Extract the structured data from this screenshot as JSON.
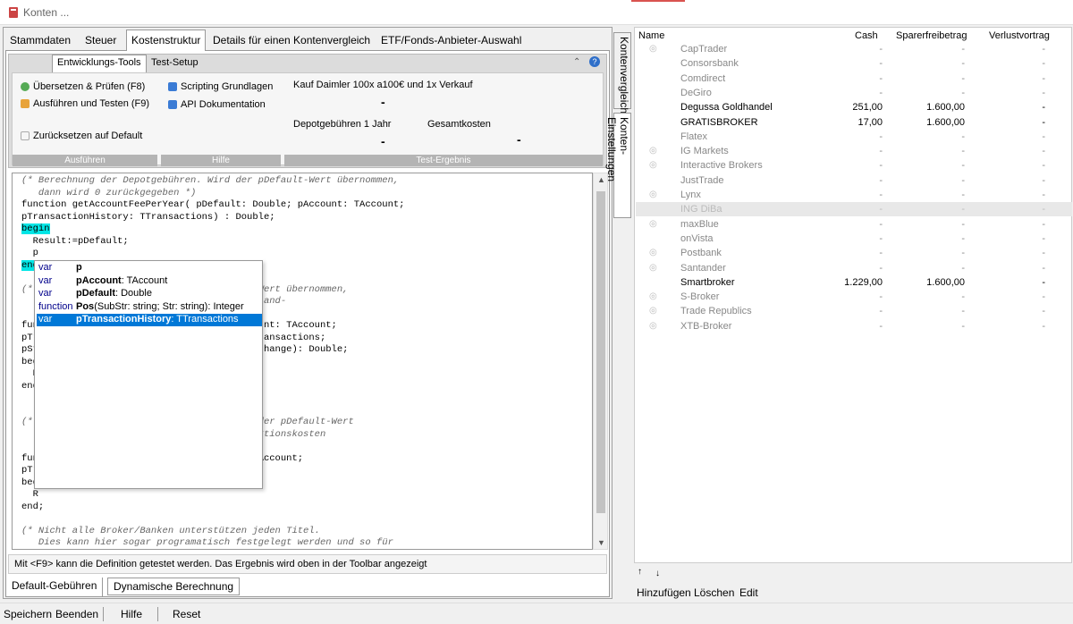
{
  "window": {
    "title": "Konten ..."
  },
  "main_tabs": [
    "Stammdaten",
    "Steuer",
    "Kostenstruktur",
    "Details für einen Kontenvergleich",
    "ETF/Fonds-Anbieter-Auswahl"
  ],
  "sub_tabs": [
    "Entwicklungs-Tools",
    "Test-Setup"
  ],
  "ribbon": {
    "ausfuehren": {
      "items": [
        "Übersetzen & Prüfen (F8)",
        "Ausführen und Testen (F9)",
        "Zurücksetzen auf Default"
      ],
      "footer": "Ausführen"
    },
    "hilfe": {
      "items": [
        "Scripting Grundlagen",
        "API Dokumentation"
      ],
      "footer": "Hilfe"
    },
    "test": {
      "title": "Kauf Daimler 100x a100€ und 1x Verkauf",
      "dash1": "-",
      "label1": "Depotgebühren 1 Jahr",
      "label2": "Gesamtkosten",
      "dash2": "-",
      "dash3": "-",
      "footer": "Test-Ergebnis"
    }
  },
  "code_lines": [
    "(* Berechnung der Depotgebühren. Wird der pDefault-Wert übernommen,",
    "   dann wird 0 zurückgegeben *)",
    "function getAccountFeePerYear( pDefault: Double; pAccount: TAccount;",
    "pTransactionHistory: TTransactions) : Double;",
    "begin",
    "  Result:=pDefault;",
    "  p",
    "end;",
    "",
    "(*                                  fault-Wert übernommen,",
    "                                    nd/Ausland-",
    "",
    "fun                                  pAccount: TAccount;",
    "pTr                                 ry: TTransactions;",
    "pSt                                 tockExchange): Double;",
    "beg",
    "  R",
    "end",
    "",
    "",
    "(*                                 . Wird der pDefault-Wert",
    "                                   -Transaktionskosten",
    "                                   ben *)",
    "fun                                ount: TAccount;",
    "pTr",
    "beg",
    "  R",
    "end;",
    "",
    "(* Nicht alle Broker/Banken unterstützen jeden Titel.",
    "   Dies kann hier sogar programatisch festgelegt werden und so für",
    "   automatische Filterungen der nutzbaren Konten nach Titelauswahl"
  ],
  "autocomplete": [
    {
      "kind": "var",
      "name": "p",
      "type": ""
    },
    {
      "kind": "var",
      "name": "pAccount",
      "type": ": TAccount"
    },
    {
      "kind": "var",
      "name": "pDefault",
      "type": ": Double"
    },
    {
      "kind": "function",
      "name": "Pos",
      "type": "(SubStr: string; Str: string): Integer"
    },
    {
      "kind": "var",
      "name": "pTransactionHistory",
      "type": ": TTransactions"
    }
  ],
  "status_message": "Mit <F9> kann die Definition getestet werden. Das Ergebnis wird oben in der Toolbar angezeigt",
  "bottom_tabs": [
    "Default-Gebühren",
    "Dynamische Berechnung"
  ],
  "vertical_tabs": [
    "Kontenvergleich",
    "Konten-Einstellungen"
  ],
  "broker_table": {
    "headers": [
      "Name",
      "Cash",
      "Sparerfreibetrag",
      "Verlustvortrag"
    ],
    "rows": [
      {
        "name": "CapTrader",
        "cash": "-",
        "spar": "-",
        "verlust": "-",
        "active": false,
        "eye": true
      },
      {
        "name": "Consorsbank",
        "cash": "-",
        "spar": "-",
        "verlust": "-",
        "active": false,
        "eye": false
      },
      {
        "name": "Comdirect",
        "cash": "-",
        "spar": "-",
        "verlust": "-",
        "active": false,
        "eye": false
      },
      {
        "name": "DeGiro",
        "cash": "-",
        "spar": "-",
        "verlust": "-",
        "active": false,
        "eye": false
      },
      {
        "name": "Degussa Goldhandel",
        "cash": "251,00",
        "spar": "1.600,00",
        "verlust": "-",
        "active": true,
        "eye": false
      },
      {
        "name": "GRATISBROKER",
        "cash": "17,00",
        "spar": "1.600,00",
        "verlust": "-",
        "active": true,
        "eye": false
      },
      {
        "name": "Flatex",
        "cash": "-",
        "spar": "-",
        "verlust": "-",
        "active": false,
        "eye": false
      },
      {
        "name": "IG Markets",
        "cash": "-",
        "spar": "-",
        "verlust": "-",
        "active": false,
        "eye": true
      },
      {
        "name": "Interactive Brokers",
        "cash": "-",
        "spar": "-",
        "verlust": "-",
        "active": false,
        "eye": true
      },
      {
        "name": "JustTrade",
        "cash": "-",
        "spar": "-",
        "verlust": "-",
        "active": false,
        "eye": false
      },
      {
        "name": "Lynx",
        "cash": "-",
        "spar": "-",
        "verlust": "-",
        "active": false,
        "eye": true
      },
      {
        "name": "ING DiBa",
        "cash": "-",
        "spar": "-",
        "verlust": "-",
        "active": false,
        "eye": false,
        "selected": true
      },
      {
        "name": "maxBlue",
        "cash": "-",
        "spar": "-",
        "verlust": "-",
        "active": false,
        "eye": true
      },
      {
        "name": "onVista",
        "cash": "-",
        "spar": "-",
        "verlust": "-",
        "active": false,
        "eye": false
      },
      {
        "name": "Postbank",
        "cash": "-",
        "spar": "-",
        "verlust": "-",
        "active": false,
        "eye": true
      },
      {
        "name": "Santander",
        "cash": "-",
        "spar": "-",
        "verlust": "-",
        "active": false,
        "eye": true
      },
      {
        "name": "Smartbroker",
        "cash": "1.229,00",
        "spar": "1.600,00",
        "verlust": "-",
        "active": true,
        "eye": false
      },
      {
        "name": "S-Broker",
        "cash": "-",
        "spar": "-",
        "verlust": "-",
        "active": false,
        "eye": true
      },
      {
        "name": "Trade Republics",
        "cash": "-",
        "spar": "-",
        "verlust": "-",
        "active": false,
        "eye": true
      },
      {
        "name": "XTB-Broker",
        "cash": "-",
        "spar": "-",
        "verlust": "-",
        "active": false,
        "eye": true
      }
    ]
  },
  "right_actions": [
    "Hinzufügen",
    "Löschen",
    "Edit"
  ],
  "bottom_actions": [
    "Speichern",
    "Beenden",
    "Hilfe",
    "Reset"
  ],
  "colors": {
    "highlight": "#00e5e5",
    "selection": "#0078d7",
    "inactive_text": "#999999"
  }
}
